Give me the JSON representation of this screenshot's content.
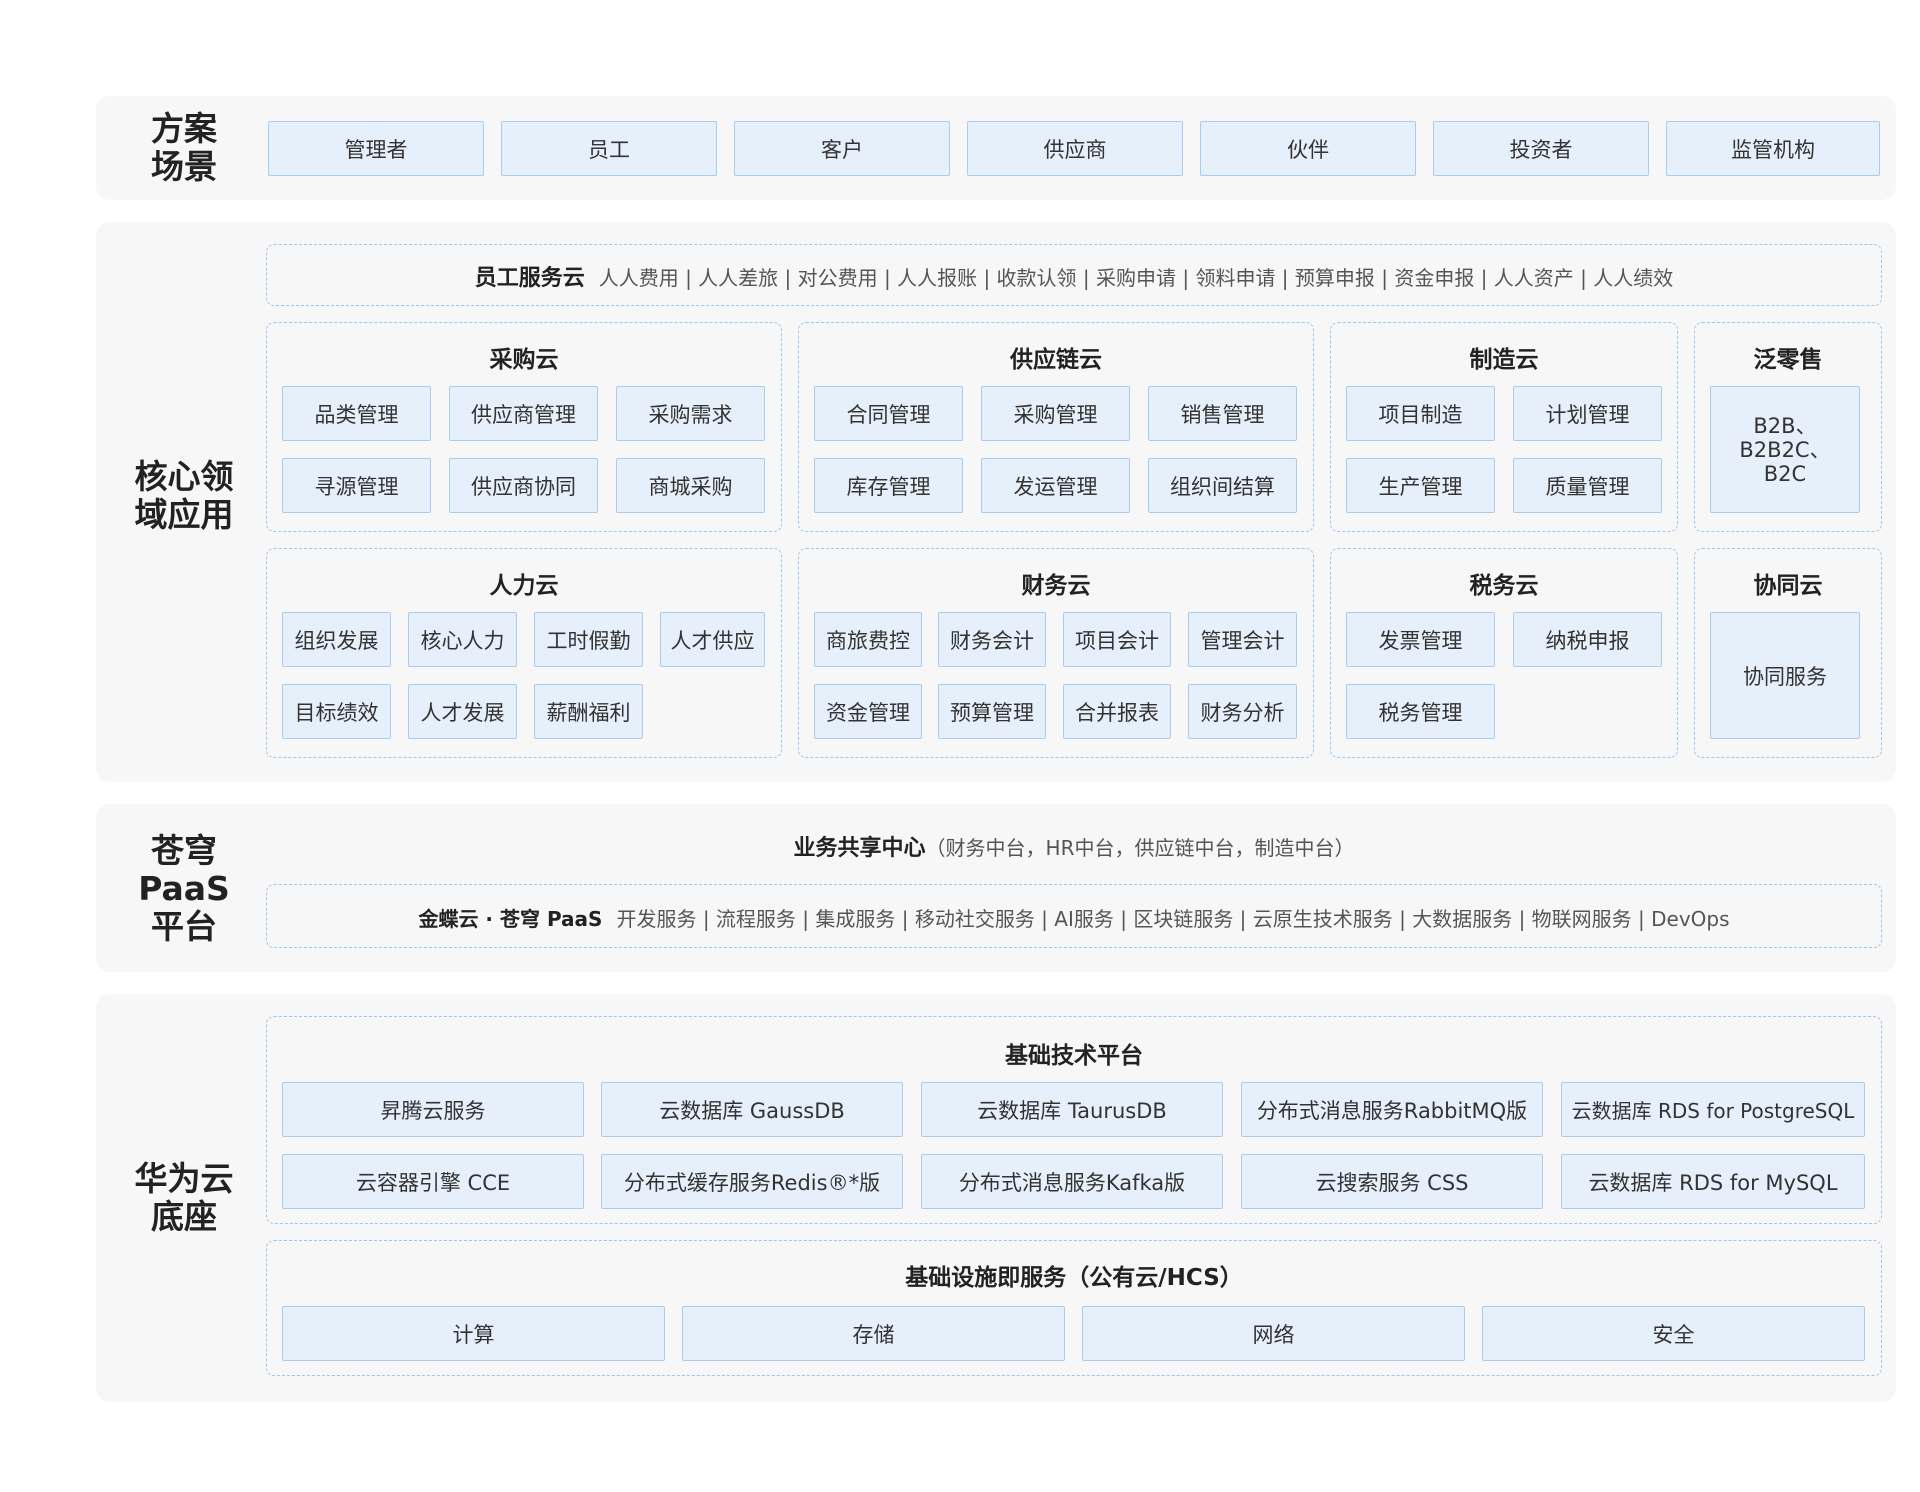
{
  "bands": {
    "scenario": {
      "label": "方案\n场景",
      "items": [
        "管理者",
        "员工",
        "客户",
        "供应商",
        "伙伴",
        "投资者",
        "监管机构"
      ]
    },
    "core": {
      "label": "核心领\n域应用",
      "employee_cloud": {
        "title": "员工服务云",
        "items": "人人费用 | 人人差旅 | 对公费用 | 人人报账 | 收款认领 | 采购申请 | 领料申请 | 预算申报 | 资金申报 | 人人资产 | 人人绩效"
      },
      "clouds": {
        "procurement": {
          "title": "采购云",
          "items": [
            "品类管理",
            "供应商管理",
            "采购需求",
            "寻源管理",
            "供应商协同",
            "商城采购"
          ]
        },
        "supply": {
          "title": "供应链云",
          "items": [
            "合同管理",
            "采购管理",
            "销售管理",
            "库存管理",
            "发运管理",
            "组织间结算"
          ]
        },
        "manufacturing": {
          "title": "制造云",
          "items": [
            "项目制造",
            "计划管理",
            "生产管理",
            "质量管理"
          ]
        },
        "retail": {
          "title": "泛零售",
          "items": [
            "B2B、\nB2B2C、\nB2C"
          ]
        },
        "hr": {
          "title": "人力云",
          "items": [
            "组织发展",
            "核心人力",
            "工时假勤",
            "人才供应",
            "目标绩效",
            "人才发展",
            "薪酬福利"
          ]
        },
        "finance": {
          "title": "财务云",
          "items": [
            "商旅费控",
            "财务会计",
            "项目会计",
            "管理会计",
            "资金管理",
            "预算管理",
            "合并报表",
            "财务分析"
          ]
        },
        "tax": {
          "title": "税务云",
          "items": [
            "发票管理",
            "纳税申报",
            "税务管理"
          ]
        },
        "collab": {
          "title": "协同云",
          "items": [
            "协同服务"
          ]
        }
      }
    },
    "paas": {
      "label": "苍穹\nPaaS\n平台",
      "shared_center": {
        "title": "业务共享中心",
        "detail": "（财务中台，HR中台，供应链中台，制造中台）"
      },
      "kingdee": {
        "title": "金蝶云 · 苍穹 PaaS",
        "items": "开发服务 | 流程服务 | 集成服务 | 移动社交服务 | AI服务 | 区块链服务 | 云原生技术服务 | 大数据服务 | 物联网服务 | DevOps"
      }
    },
    "huawei": {
      "label": "华为云\n底座",
      "tech_platform": {
        "title": "基础技术平台",
        "items": [
          "昇腾云服务",
          "云数据库 GaussDB",
          "云数据库 TaurusDB",
          "分布式消息服务RabbitMQ版",
          "云数据库 RDS for PostgreSQL",
          "云容器引擎 CCE",
          "分布式缓存服务Redis®*版",
          "分布式消息服务Kafka版",
          "云搜索服务 CSS",
          "云数据库 RDS for MySQL"
        ]
      },
      "iaas": {
        "title": "基础设施即服务（公有云/HCS）",
        "items": [
          "计算",
          "存储",
          "网络",
          "安全"
        ]
      }
    }
  }
}
